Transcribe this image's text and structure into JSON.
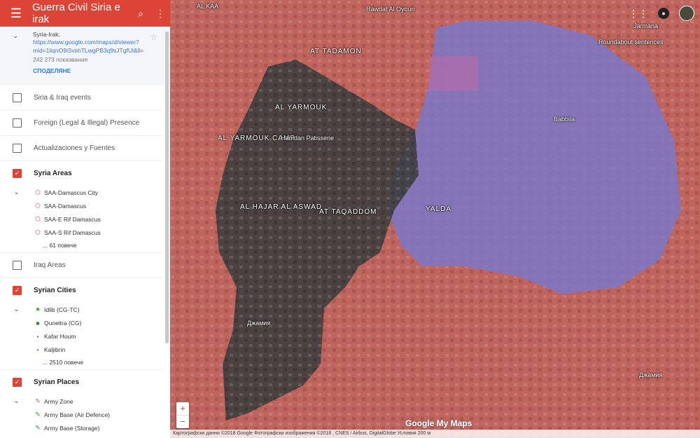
{
  "app": {
    "title": "Guerra Civil Siria e irak"
  },
  "info": {
    "name": "Syria-Irak:",
    "url": "https://www.google.com/maps/d/viewer?mid=1liqnO9iSvshTLwgPB3q9sJTgfUl&ll=",
    "views": "242 273 показвания",
    "share": "СПОДЕЛЯНЕ"
  },
  "layers": [
    {
      "label": "Siria & Iraq events",
      "checked": false
    },
    {
      "label": "Foreign (Legal & Illegal) Presence",
      "checked": false
    },
    {
      "label": "Actualizaciones y Fuentes",
      "checked": false
    },
    {
      "label": "Syria Areas",
      "checked": true,
      "items": [
        "SAA-Damascus City",
        "SAA-Damascus",
        "SAA-E Rif Damascus",
        "SAA-S Rif Damascus"
      ],
      "more": "... 61 повече"
    },
    {
      "label": "Iraq Areas",
      "checked": false
    },
    {
      "label": "Syrian Cities",
      "checked": true,
      "items": [
        "Idlib (CG-TC)",
        "Quneitra (CG)",
        "Kafar Houm",
        "Kaljibrin"
      ],
      "more": "... 2510 повече"
    },
    {
      "label": "Syrian Places",
      "checked": true,
      "items": [
        "Army Zone",
        "Army Base (Air Defence)",
        "Army Base (Storage)"
      ]
    }
  ],
  "map": {
    "labels": [
      "AT TADAMON",
      "AL YARMOUK",
      "AL YARMOUK CAMP",
      "Hamdan Patisserie",
      "Babbila",
      "AL HAJAR AL ASWAD",
      "AT TAQADDOM",
      "YALDA",
      "Roundabout sentences",
      "Джамия",
      "Джамия",
      "Rawdat Al Oyoun",
      "Jarmana",
      "АL KAA"
    ],
    "zoom_in": "+",
    "zoom_out": "−",
    "logo": "Google My Maps",
    "attribution": "Картографски данни ©2018 Google Фотографски изображения ©2018 , CNES / Airbus, DigitalGlobe   Условия   200 м"
  },
  "colors": {
    "accent": "#db4437",
    "regime": "#c8645f",
    "isis": "#3a3a3a",
    "rebel": "#7a78c8"
  }
}
